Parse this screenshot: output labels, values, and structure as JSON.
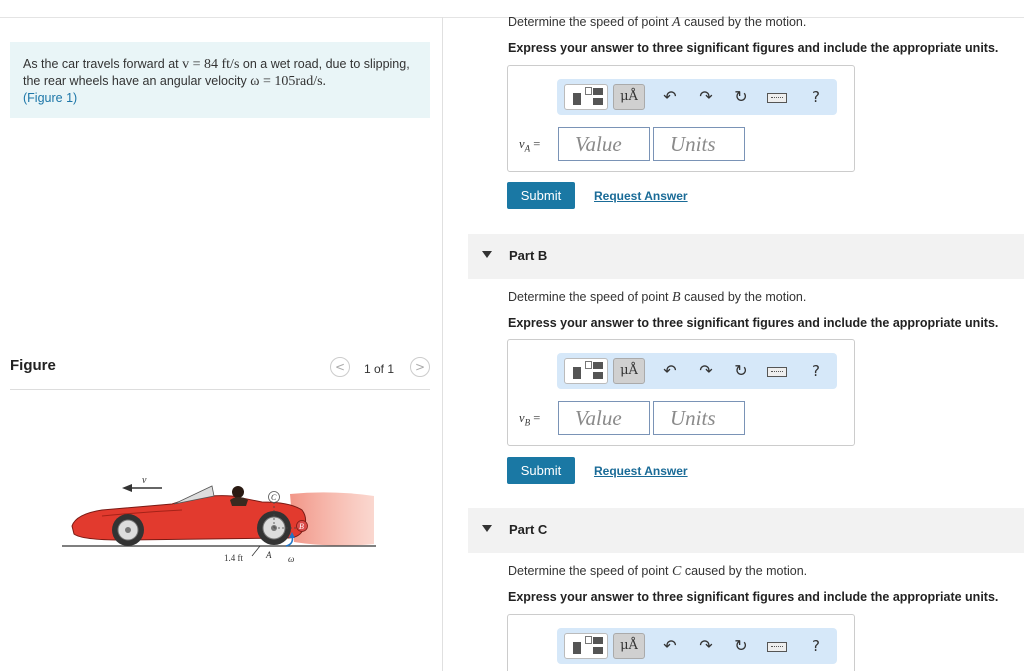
{
  "problem": {
    "text_before_v": "As the car travels forward at",
    "v_expr": "v = 84 ft/s",
    "text_before_omega": "on a wet road, due to slipping, the rear wheels have an angular velocity",
    "omega_expr": "ω = 105rad/s.",
    "figure_link": "(Figure 1)"
  },
  "figure": {
    "title": "Figure",
    "counter": "1 of 1",
    "prev_icon": "chevron-left-icon",
    "next_icon": "chevron-right-icon",
    "labels": {
      "v": "v",
      "C": "C",
      "B": "B",
      "A": "A",
      "omega": "ω",
      "dim": "1.4 ft"
    }
  },
  "toolbar": {
    "units_label": "μÅ",
    "undo_icon": "↶",
    "redo_icon": "↷",
    "reset_icon": "↻",
    "help_label": "?"
  },
  "inputs": {
    "value_placeholder": "Value",
    "units_placeholder": "Units"
  },
  "parts": {
    "a": {
      "prompt_before": "Determine the speed of point",
      "point": "A",
      "prompt_after": "caused by the motion.",
      "instruction": "Express your answer to three significant figures and include the appropriate units.",
      "var_symbol": "v",
      "var_sub": "A",
      "eq": "=",
      "submit_label": "Submit",
      "request_label": "Request Answer"
    },
    "b": {
      "title": "Part B",
      "prompt_before": "Determine the speed of point",
      "point": "B",
      "prompt_after": "caused by the motion.",
      "instruction": "Express your answer to three significant figures and include the appropriate units.",
      "var_symbol": "v",
      "var_sub": "B",
      "eq": "=",
      "submit_label": "Submit",
      "request_label": "Request Answer"
    },
    "c": {
      "title": "Part C",
      "prompt_before": "Determine the speed of point",
      "point": "C",
      "prompt_after": "caused by the motion.",
      "instruction": "Express your answer to three significant figures and include the appropriate units."
    }
  },
  "colors": {
    "accent": "#1a78a4",
    "problem_bg": "#e9f5f7",
    "toolbar_bg": "#d6e8f9",
    "car_red": "#e23a2e"
  }
}
